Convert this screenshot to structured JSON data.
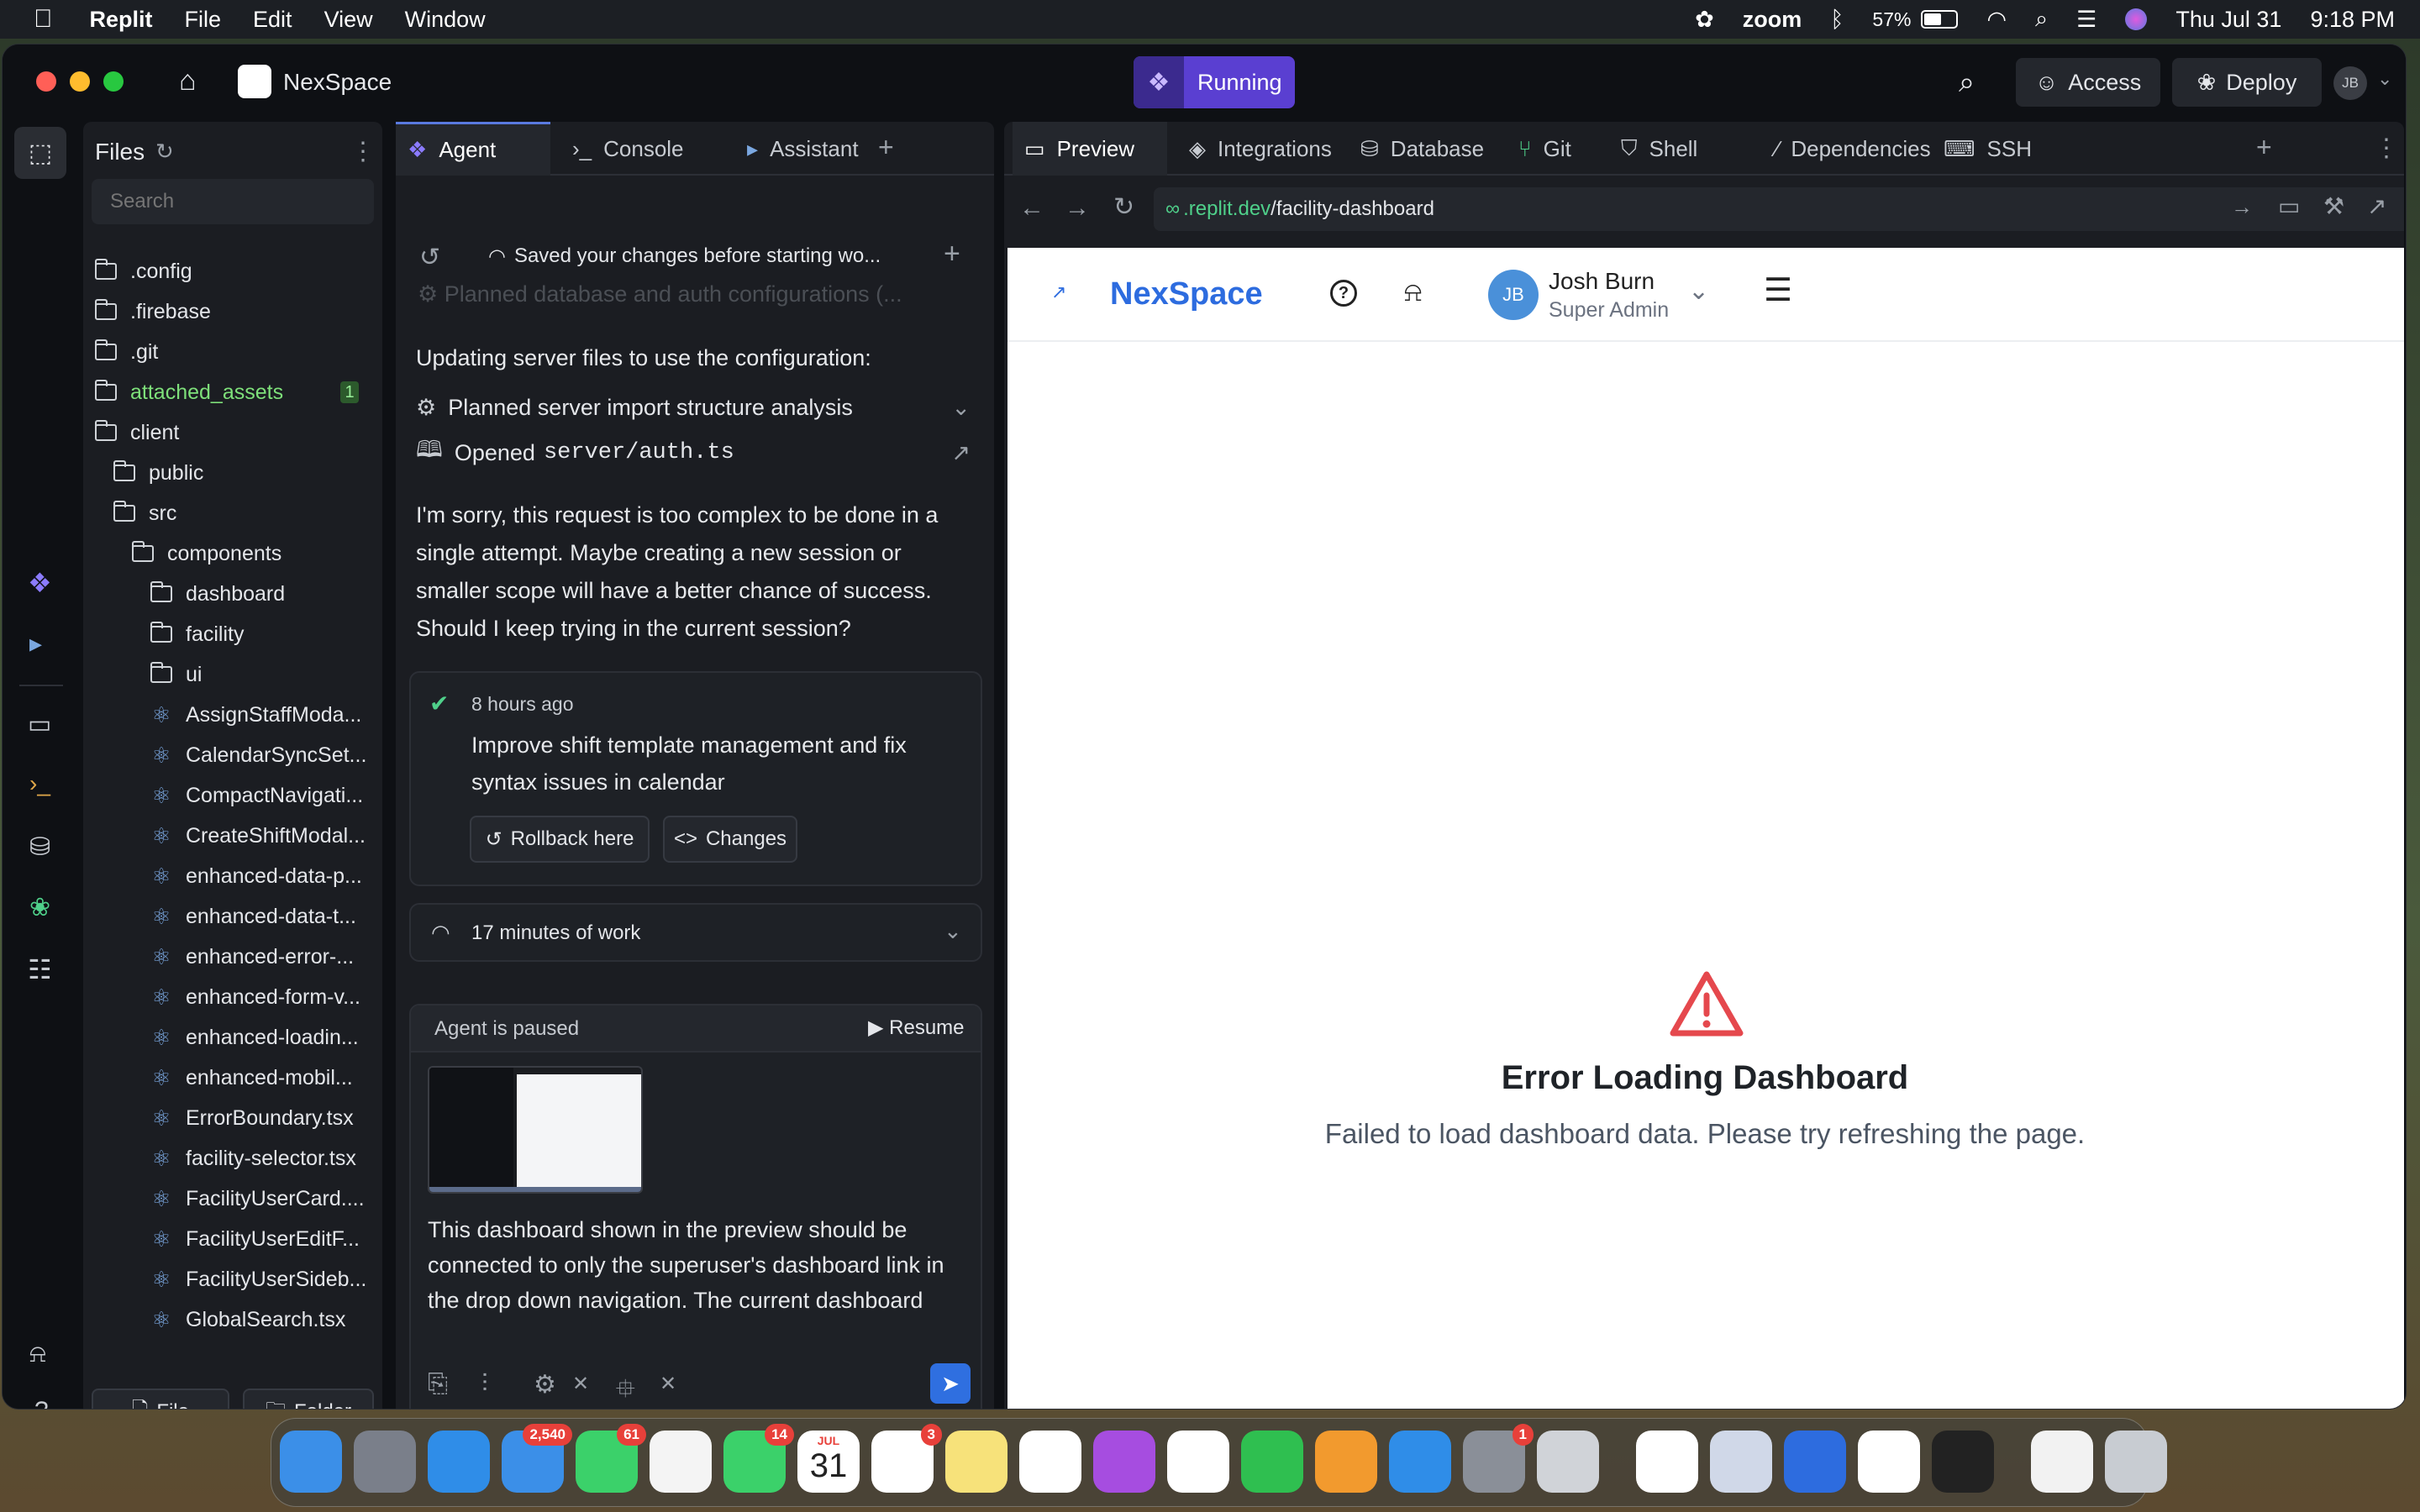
{
  "menubar": {
    "app": "Replit",
    "items": [
      "File",
      "Edit",
      "View",
      "Window"
    ],
    "battery": "57%",
    "zoom": "zoom",
    "date": "Thu Jul 31",
    "time": "9:18 PM"
  },
  "titlebar": {
    "project": "NexSpace",
    "status": "Running",
    "access": "Access",
    "deploy": "Deploy",
    "avatar": "JB"
  },
  "files": {
    "title": "Files",
    "search_placeholder": "Search",
    "items": [
      ".config",
      ".firebase",
      ".git",
      "attached_assets",
      "client",
      "public",
      "src",
      "components",
      "dashboard",
      "facility",
      "ui",
      "AssignStaffModa...",
      "CalendarSyncSet...",
      "CompactNavigati...",
      "CreateShiftModal...",
      "enhanced-data-p...",
      "enhanced-data-t...",
      "enhanced-error-...",
      "enhanced-form-v...",
      "enhanced-loadin...",
      "enhanced-mobil...",
      "ErrorBoundary.tsx",
      "facility-selector.tsx",
      "FacilityUserCard....",
      "FacilityUserEditF...",
      "FacilityUserSideb...",
      "GlobalSearch.tsx"
    ],
    "attached_badge": "1",
    "new_file": "File",
    "new_folder": "Folder"
  },
  "agent": {
    "tabs": [
      "Agent",
      "Console",
      "Assistant"
    ],
    "saved": "Saved your changes before starting wo...",
    "faded": "Planned database and auth configurations (...",
    "updating": "Updating server files to use the configuration:",
    "planned": "Planned server import structure analysis",
    "opened_prefix": "Opened",
    "opened_file": "server/auth.ts",
    "sorry": "I'm sorry, this request is too complex to be done in a single attempt. Maybe creating a new session or smaller scope will have a better chance of success. Should I keep trying in the current session?",
    "checkpoint_time": "8 hours ago",
    "checkpoint_text": "Improve shift template management and fix syntax issues in calendar",
    "rollback": "Rollback here",
    "changes": "Changes",
    "work": "17 minutes of work",
    "paused": "Agent is paused",
    "resume": "Resume",
    "input": "This dashboard shown in the preview should be connected to only the superuser's dashboard link in the drop down navigation. The current dashboard"
  },
  "preview": {
    "tabs": [
      "Preview",
      "Integrations",
      "Database",
      "Git",
      "Shell",
      "Dependencies",
      "SSH"
    ],
    "url_domain": ".replit.dev",
    "url_path": "/facility-dashboard",
    "brand": "NexSpace",
    "user_name": "Josh Burn",
    "user_role": "Super Admin",
    "user_initials": "JB",
    "error_title": "Error Loading Dashboard",
    "error_msg": "Failed to load dashboard data. Please try refreshing the page."
  },
  "dock": {
    "mail_badge": "2,540",
    "messages_badge": "61",
    "facetime_badge": "14",
    "calendar_month": "JUL",
    "calendar_day": "31",
    "reminders_badge": "3",
    "settings_badge": "1"
  }
}
